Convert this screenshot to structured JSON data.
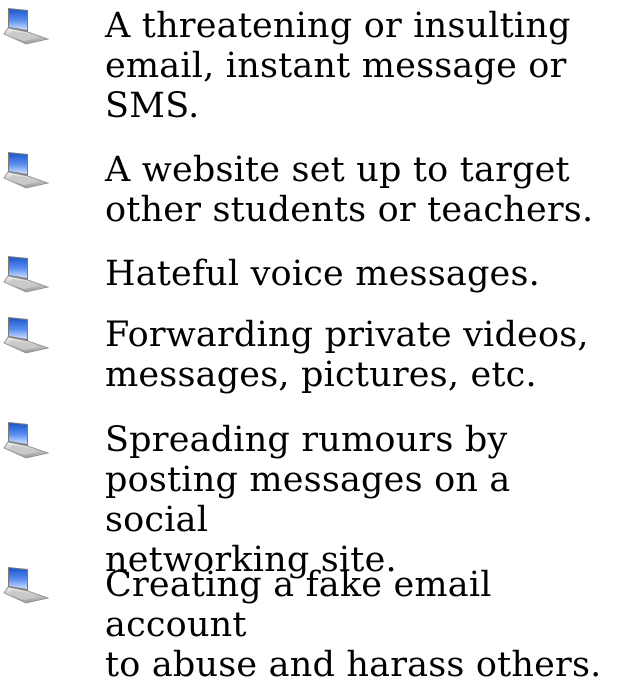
{
  "bullets": {
    "icon": "laptop-icon",
    "items": [
      {
        "text": "A threatening or insulting\nemail, instant message or\nSMS."
      },
      {
        "text": "A website set up to target\nother students or teachers."
      },
      {
        "text": "Hateful voice messages."
      },
      {
        "text": "Forwarding private videos,\nmessages, pictures, etc."
      },
      {
        "text": "Spreading rumours by\nposting messages on a social\nnetworking site."
      },
      {
        "text": "Creating a fake email account\nto abuse and harass others."
      }
    ]
  }
}
